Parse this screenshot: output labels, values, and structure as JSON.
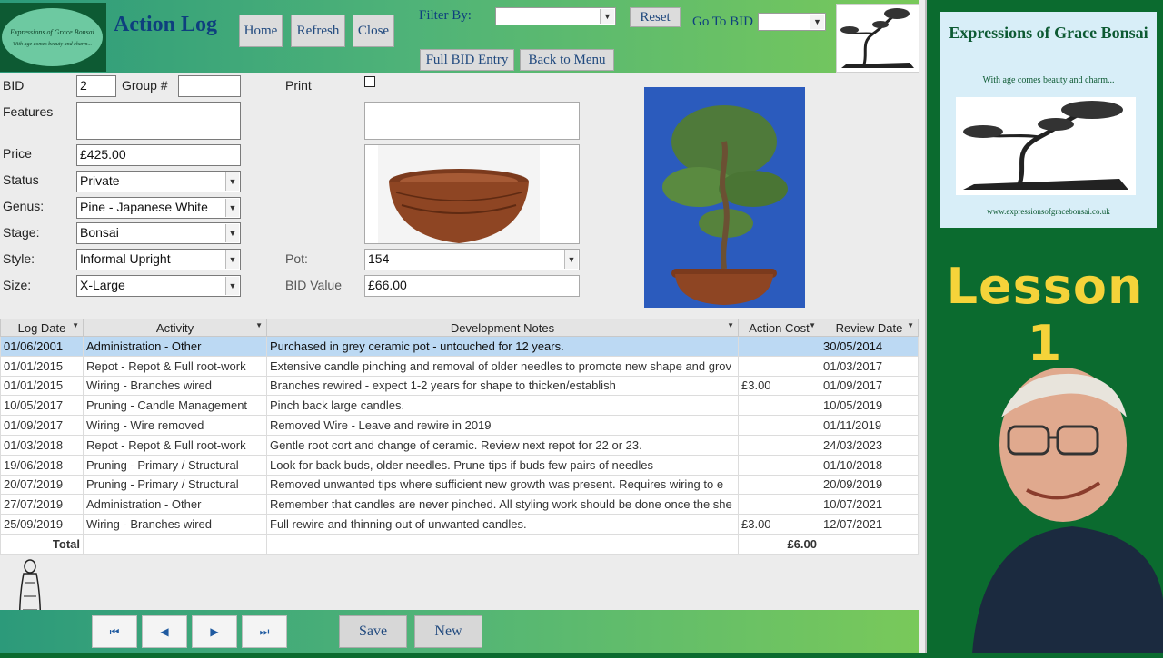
{
  "header": {
    "logo_title": "Expressions of Grace Bonsai",
    "logo_tagline": "With age comes beauty and charm...",
    "title": "Action Log",
    "home_label": "Home",
    "refresh_label": "Refresh",
    "close_label": "Close",
    "filter_label": "Filter By:",
    "filter_value": "",
    "reset_label": "Reset",
    "goto_label": "Go To BID",
    "goto_value": "",
    "full_bid_label": "Full BID Entry",
    "back_label": "Back to Menu"
  },
  "form": {
    "bid_label": "BID",
    "bid_value": "2",
    "group_label": "Group #",
    "group_value": "",
    "print_label": "Print",
    "print_checked": false,
    "features_label": "Features",
    "features_value": "",
    "features2_value": "",
    "price_label": "Price",
    "price_value": "£425.00",
    "status_label": "Status",
    "status_value": "Private",
    "genus_label": "Genus:",
    "genus_value": "Pine - Japanese White",
    "stage_label": "Stage:",
    "stage_value": "Bonsai",
    "style_label": "Style:",
    "style_value": "Informal Upright",
    "size_label": "Size:",
    "size_value": "X-Large",
    "pot_label": "Pot:",
    "pot_value": "154",
    "bid_value_label": "BID Value",
    "bid_value_amount": "£66.00"
  },
  "grid": {
    "columns": [
      "Log Date",
      "Activity",
      "Development Notes",
      "Action Cost",
      "Review Date"
    ],
    "rows": [
      [
        "01/06/2001",
        "Administration - Other",
        "Purchased in grey ceramic pot - untouched for 12 years.",
        "",
        "30/05/2014"
      ],
      [
        "01/01/2015",
        "Repot - Repot & Full root-work",
        "Extensive candle pinching and removal of older needles to promote new shape and grov",
        "",
        "01/03/2017"
      ],
      [
        "01/01/2015",
        "Wiring - Branches wired",
        "Branches rewired - expect 1-2 years for shape to thicken/establish",
        "£3.00",
        "01/09/2017"
      ],
      [
        "10/05/2017",
        "Pruning - Candle Management",
        "Pinch back large candles.",
        "",
        "10/05/2019"
      ],
      [
        "01/09/2017",
        "Wiring - Wire removed",
        "Removed Wire - Leave and rewire in 2019",
        "",
        "01/11/2019"
      ],
      [
        "01/03/2018",
        "Repot - Repot & Full root-work",
        "Gentle root cort and change of ceramic. Review next repot for 22 or 23.",
        "",
        "24/03/2023"
      ],
      [
        "19/06/2018",
        "Pruning - Primary / Structural",
        "Look for back buds, older needles. Prune tips if buds few pairs of needles",
        "",
        "01/10/2018"
      ],
      [
        "20/07/2019",
        "Pruning - Primary / Structural",
        "Removed unwanted tips where sufficient new growth was present.  Requires wiring to e",
        "",
        "20/09/2019"
      ],
      [
        "27/07/2019",
        "Administration - Other",
        "Remember that candles are never pinched. All styling work should be done once the she",
        "",
        "10/07/2021"
      ],
      [
        "25/09/2019",
        "Wiring - Branches wired",
        "Full rewire and thinning out of unwanted candles.",
        "£3.00",
        "12/07/2021"
      ]
    ],
    "total_label": "Total",
    "total_value": "£6.00"
  },
  "footer": {
    "first_icon": "first-record-icon",
    "prev_icon": "previous-record-icon",
    "next_icon": "next-record-icon",
    "last_icon": "last-record-icon",
    "save_label": "Save",
    "new_label": "New"
  },
  "side_panel": {
    "card_title": "Expressions of Grace Bonsai",
    "card_tagline": "With age comes beauty and charm...",
    "card_url": "www.expressionsofgracebonsai.co.uk",
    "lesson_text": "Lesson 1"
  },
  "colors": {
    "accent_blue": "#0e3f7e",
    "selected_row": "#bcd9f3",
    "lesson_yellow": "#f5d33a",
    "side_green": "#0b6b2f"
  }
}
